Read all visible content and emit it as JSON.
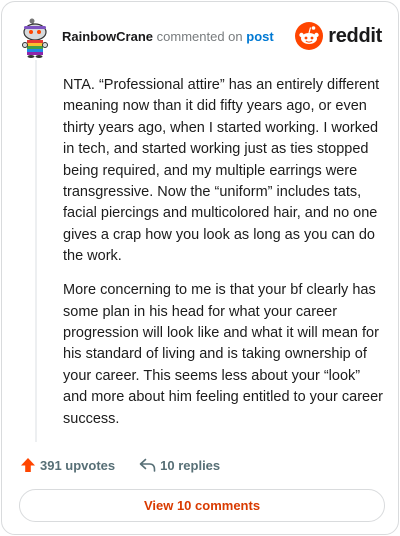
{
  "comment": {
    "username": "RainbowCrane",
    "action_text": "commented on",
    "target_text": "post",
    "paragraphs": [
      "NTA. “Professional attire” has an entirely different meaning now than it did fifty years ago, or even thirty years ago, when I started working. I worked in tech, and started working just as ties stopped being required, and my multiple earrings were transgressive. Now the “uniform” includes tats, facial piercings and multicolored hair, and no one gives a crap how you look as long as you can do the work.",
      "More concerning to me is that your bf clearly has some plan in his head for what your career progression will look like and what it will mean for his standard of living and is taking ownership of your career. This seems less about your “look” and more about him feeling entitled to your career success."
    ]
  },
  "brand": {
    "name": "reddit",
    "color": "#ff4500"
  },
  "actions": {
    "upvotes": "391 upvotes",
    "replies": "10 replies"
  },
  "view_button": {
    "label": "View 10 comments",
    "color": "#d93a00"
  },
  "icons": {
    "avatar": "snoo-avatar-icon",
    "logo": "reddit-snoo-icon",
    "upvote": "upvote-arrow-icon",
    "reply": "reply-arrow-icon"
  }
}
